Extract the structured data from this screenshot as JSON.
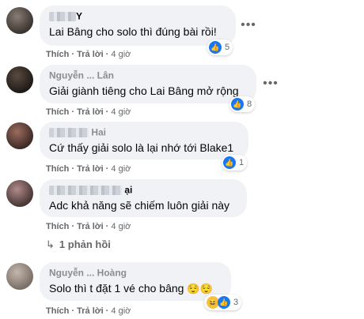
{
  "comments": [
    {
      "name_visible": "Y",
      "text": "Lai Bâng cho solo thì đúng bài rồi!",
      "reactions": "5",
      "meta": {
        "like": "Thích",
        "reply": "Trả lời",
        "time": "4 giờ"
      }
    },
    {
      "name_visible": "Nguyễn ... Lân",
      "text": "Giải giành tiêng cho Lai Bâng mở rộng",
      "reactions": "8",
      "meta": {
        "like": "Thích",
        "reply": "Trả lời",
        "time": "4 giờ"
      }
    },
    {
      "name_visible": "Hai",
      "text": "Cứ thấy giải solo là lại nhớ tới Blake1",
      "reactions": "1",
      "meta": {
        "like": "Thích",
        "reply": "Trả lời",
        "time": "4 giờ"
      }
    },
    {
      "name_visible": "ại",
      "text": "Adc khả năng sẽ chiếm luôn giải này",
      "reactions": "",
      "meta": {
        "like": "Thích",
        "reply": "Trả lời",
        "time": "4 giờ"
      }
    },
    {
      "name_visible": "Nguyễn ... Hoàng",
      "text": "Solo thì t đặt 1 vé cho bâng",
      "emoji": "😌😌",
      "reactions": "3",
      "meta": {
        "like": "Thích",
        "reply": "Trả lời",
        "time": "4 giờ"
      }
    }
  ],
  "replies_label": "1 phản hồi",
  "icons": {
    "more": "more-options-icon",
    "like": "like-icon",
    "haha": "haha-icon",
    "reply_arrow": "reply-arrow-icon"
  },
  "colors": {
    "bubble": "#f0f2f5",
    "like": "#1877f2",
    "meta": "#65676b"
  }
}
